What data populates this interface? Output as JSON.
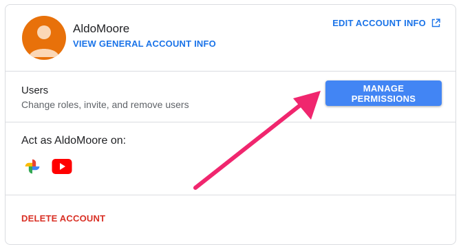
{
  "profile": {
    "username": "AldoMoore",
    "view_general_label": "VIEW GENERAL ACCOUNT INFO",
    "edit_account_label": "EDIT ACCOUNT INFO",
    "avatar_color": "#e8710a"
  },
  "users": {
    "title": "Users",
    "description": "Change roles, invite, and remove users",
    "manage_permissions_label": "MANAGE PERMISSIONS"
  },
  "act_as": {
    "title": "Act as AldoMoore on:",
    "apps": [
      "google-photos-icon",
      "youtube-icon"
    ]
  },
  "delete_account_label": "DELETE ACCOUNT",
  "colors": {
    "link_blue": "#1a73e8",
    "button_blue": "#4285f4",
    "delete_red": "#d93025",
    "annotation_arrow": "#f0266e"
  }
}
